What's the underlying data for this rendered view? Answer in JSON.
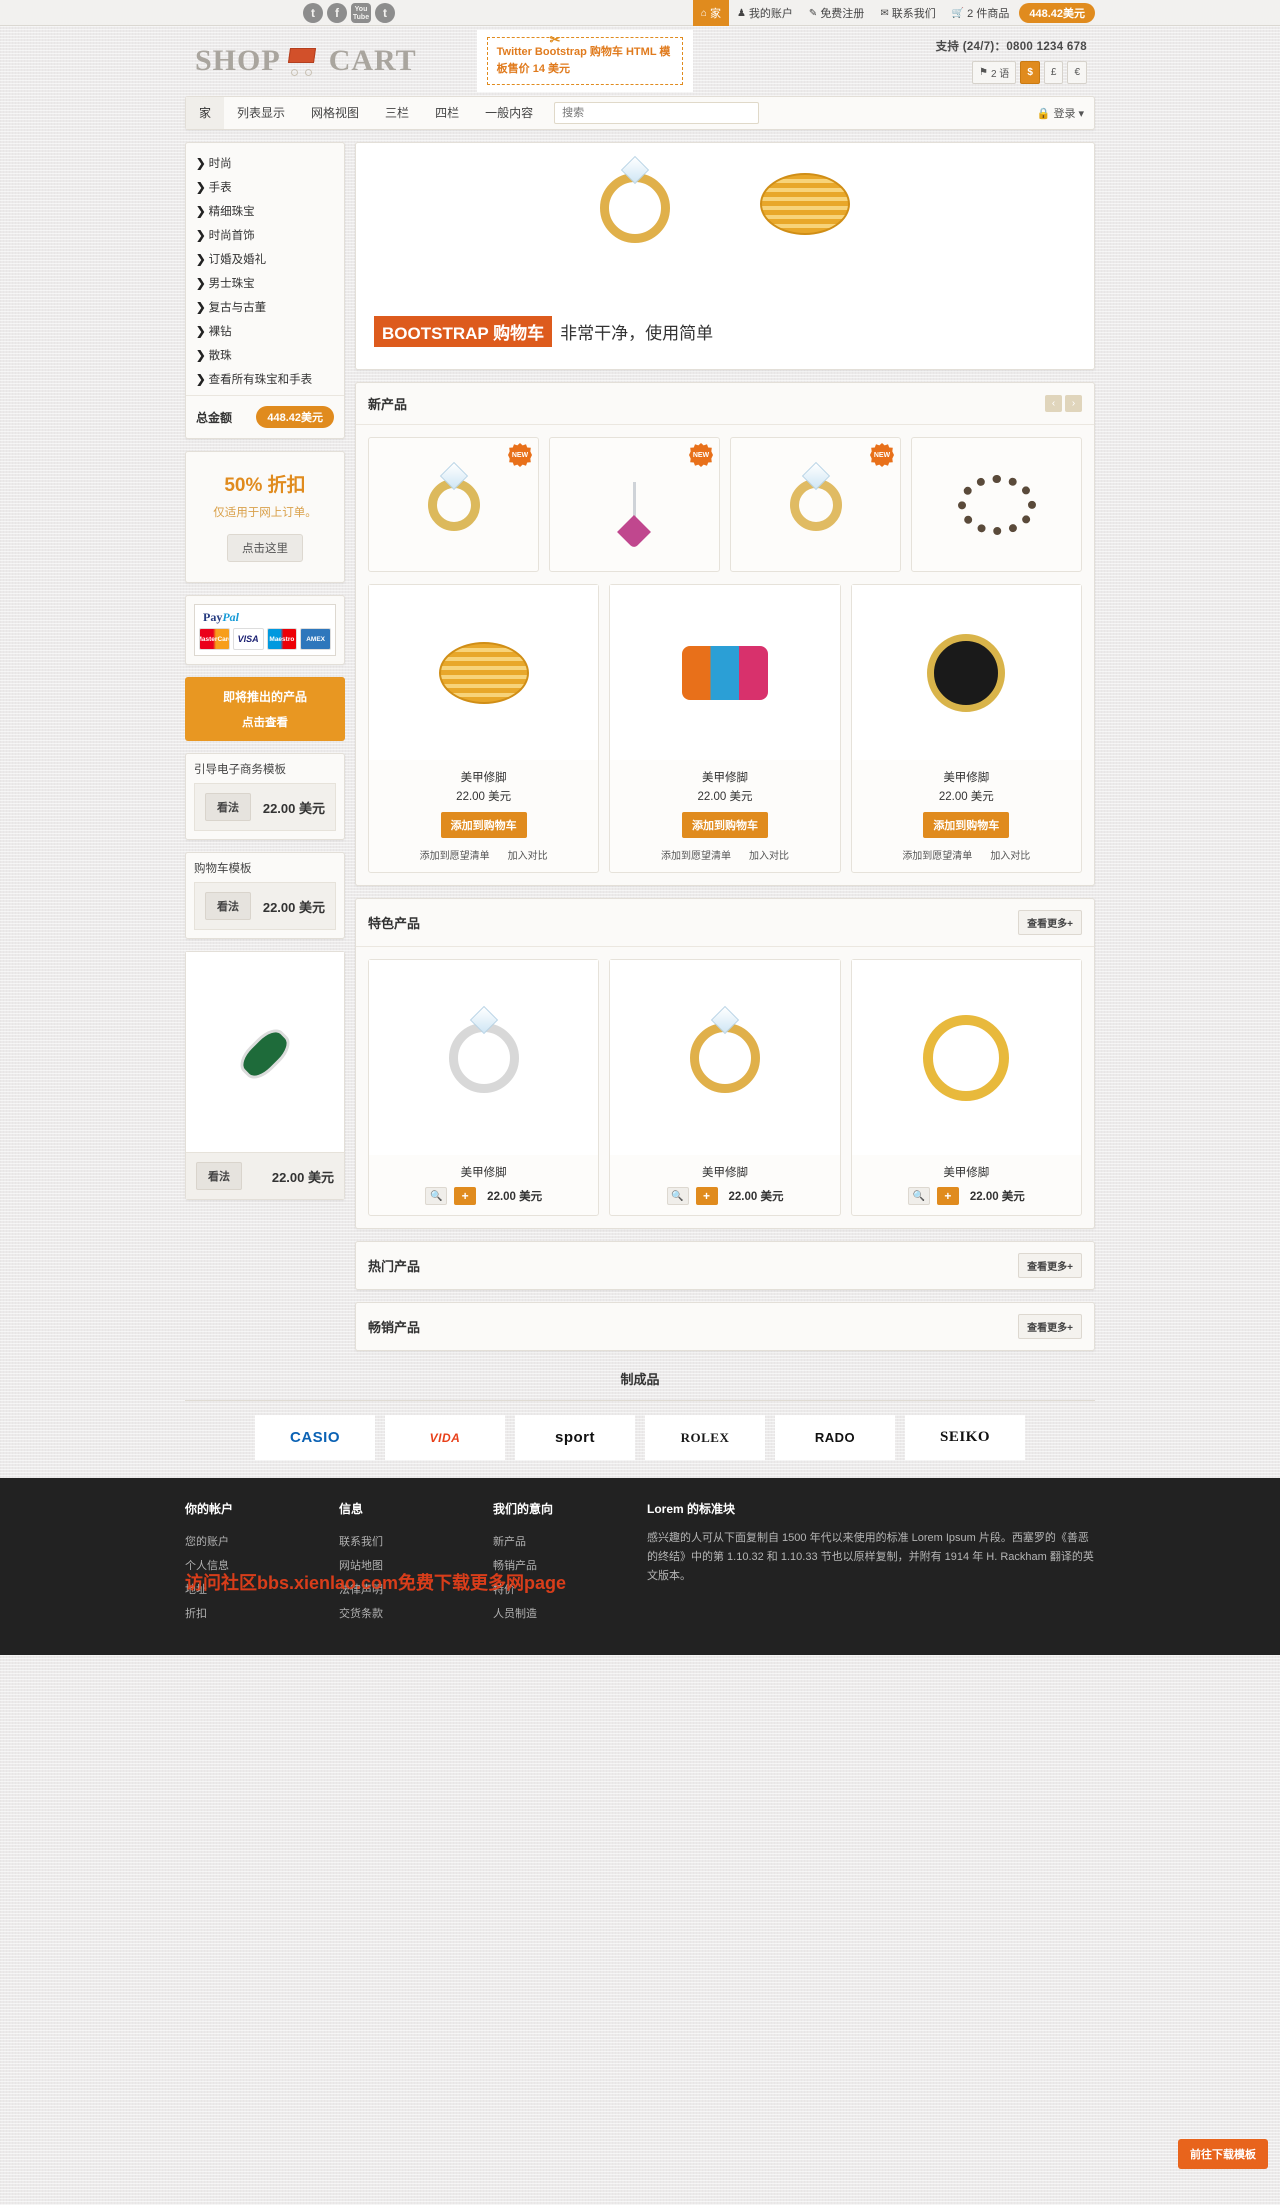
{
  "topbar": {
    "social": [
      {
        "name": "twitter-icon",
        "glyph": "t"
      },
      {
        "name": "facebook-icon",
        "glyph": "f"
      },
      {
        "name": "youtube-icon",
        "glyph": "You Tube"
      },
      {
        "name": "tumblr-icon",
        "glyph": "t"
      }
    ],
    "links": [
      {
        "label": "家",
        "icon": "home-icon",
        "glyph": "⌂",
        "active": true
      },
      {
        "label": "我的账户",
        "icon": "user-icon",
        "glyph": "♟",
        "active": false
      },
      {
        "label": "免费注册",
        "icon": "register-icon",
        "glyph": "✎",
        "active": false
      },
      {
        "label": "联系我们",
        "icon": "mail-icon",
        "glyph": "✉",
        "active": false
      },
      {
        "label": "2 件商品",
        "icon": "cart-icon",
        "glyph": "⛉",
        "active": false
      }
    ],
    "cart_total": "448.42美元"
  },
  "header": {
    "logo_left": "SHOP",
    "logo_right": "CART",
    "logo_icon": "shopping-cart-icon",
    "promo_text": "Twitter Bootstrap 购物车 HTML 模板售价 14 美元",
    "support_label": "支持 (24/7)：",
    "support_phone": "0800 1234 678",
    "switchers": [
      {
        "name": "language-switcher",
        "label": "2 语",
        "icon": "flag-icon",
        "active": false
      },
      {
        "name": "currency-usd",
        "label": "$",
        "active": true
      },
      {
        "name": "currency-gbp",
        "label": "£",
        "active": false
      },
      {
        "name": "currency-eur",
        "label": "€",
        "active": false
      }
    ]
  },
  "mainnav": {
    "items": [
      {
        "label": "家",
        "active": true
      },
      {
        "label": "列表显示",
        "active": false
      },
      {
        "label": "网格视图",
        "active": false
      },
      {
        "label": "三栏",
        "active": false
      },
      {
        "label": "四栏",
        "active": false
      },
      {
        "label": "一般内容",
        "active": false
      }
    ],
    "search_placeholder": "搜索",
    "search_value": "",
    "login_label": "登录",
    "login_icon": "lock-icon"
  },
  "sidebar": {
    "categories": [
      "时尚",
      "手表",
      "精细珠宝",
      "时尚首饰",
      "订婚及婚礼",
      "男士珠宝",
      "复古与古董",
      "裸钻",
      "散珠",
      "查看所有珠宝和手表"
    ],
    "total_label": "总金额",
    "total_value": "448.42美元",
    "discount": {
      "headline": "50% 折扣",
      "sub": "仅适用于网上订单。",
      "button": "点击这里"
    },
    "payments": {
      "paypal": "PayPal",
      "cards": [
        "MasterCard",
        "VISA",
        "Maestro",
        "AMEX"
      ]
    },
    "coming_soon": {
      "title": "即将推出的产品",
      "cta": "点击查看"
    },
    "widgets": [
      {
        "title": "引导电子商务模板",
        "button": "看法",
        "price": "22.00 美元"
      },
      {
        "title": "购物车模板",
        "button": "看法",
        "price": "22.00 美元"
      }
    ],
    "featured_widget": {
      "button": "看法",
      "price": "22.00 美元",
      "image": "gemstone-ring-image"
    }
  },
  "hero": {
    "tag": "BOOTSTRAP 购物车",
    "subtitle": "非常干净，使用简单",
    "images": [
      "diamond-ring-image",
      "gold-bangles-image"
    ]
  },
  "sections": {
    "new_products": {
      "title": "新产品",
      "prev_icon": "chevron-left-icon",
      "next_icon": "chevron-right-icon",
      "top_row": [
        {
          "badge": "NEW",
          "image": "emerald-ring-image"
        },
        {
          "badge": "NEW",
          "image": "heart-pendant-image"
        },
        {
          "badge": "NEW",
          "image": "solitaire-ring-image"
        },
        {
          "badge": "",
          "image": "charm-bracelet-image"
        }
      ],
      "cards": [
        {
          "name": "美甲修脚",
          "price": "22.00 美元",
          "add": "添加到购物车",
          "wishlist": "添加到愿望清单",
          "compare": "加入对比",
          "image": "gold-bangles-image"
        },
        {
          "name": "美甲修脚",
          "price": "22.00 美元",
          "add": "添加到购物车",
          "wishlist": "添加到愿望清单",
          "compare": "加入对比",
          "image": "sport-bands-image"
        },
        {
          "name": "美甲修脚",
          "price": "22.00 美元",
          "add": "添加到购物车",
          "wishlist": "添加到愿望清单",
          "compare": "加入对比",
          "image": "luxury-watch-image"
        }
      ]
    },
    "featured": {
      "title": "特色产品",
      "viewmore": "查看更多+",
      "cards": [
        {
          "name": "美甲修脚",
          "price": "22.00 美元",
          "zoom_icon": "magnifier-icon",
          "add_icon": "plus-icon",
          "image": "diamond-band-ring-image"
        },
        {
          "name": "美甲修脚",
          "price": "22.00 美元",
          "zoom_icon": "magnifier-icon",
          "add_icon": "plus-icon",
          "image": "solitaire-ring-image"
        },
        {
          "name": "美甲修脚",
          "price": "22.00 美元",
          "zoom_icon": "magnifier-icon",
          "add_icon": "plus-icon",
          "image": "gold-necklace-image"
        }
      ]
    },
    "popular": {
      "title": "热门产品",
      "viewmore": "查看更多+"
    },
    "bestsellers": {
      "title": "畅销产品",
      "viewmore": "查看更多+"
    }
  },
  "brands": {
    "title": "制成品",
    "items": [
      "CASIO",
      "VIDA",
      "sport",
      "ROLEX",
      "RADO",
      "SEIKO"
    ]
  },
  "footer": {
    "columns": [
      {
        "title": "你的帐户",
        "links": [
          "您的账户",
          "个人信息",
          "地址",
          "折扣"
        ]
      },
      {
        "title": "信息",
        "links": [
          "联系我们",
          "网站地图",
          "法律声明",
          "交货条款"
        ]
      },
      {
        "title": "我们的意向",
        "links": [
          "新产品",
          "畅销产品",
          "特价",
          "人员制造"
        ]
      }
    ],
    "about": {
      "title": "Lorem 的标准块",
      "text": "感兴趣的人可从下面复制自 1500 年代以来使用的标准 Lorem Ipsum 片段。西塞罗的《善恶的终结》中的第 1.10.32 和 1.10.33 节也以原样复制，并附有 1914 年 H. Rackham 翻译的英文版本。"
    },
    "download_button": "前往下载模板",
    "watermark": "访问社区bbs.xienlao.com免费下载更多网page"
  }
}
